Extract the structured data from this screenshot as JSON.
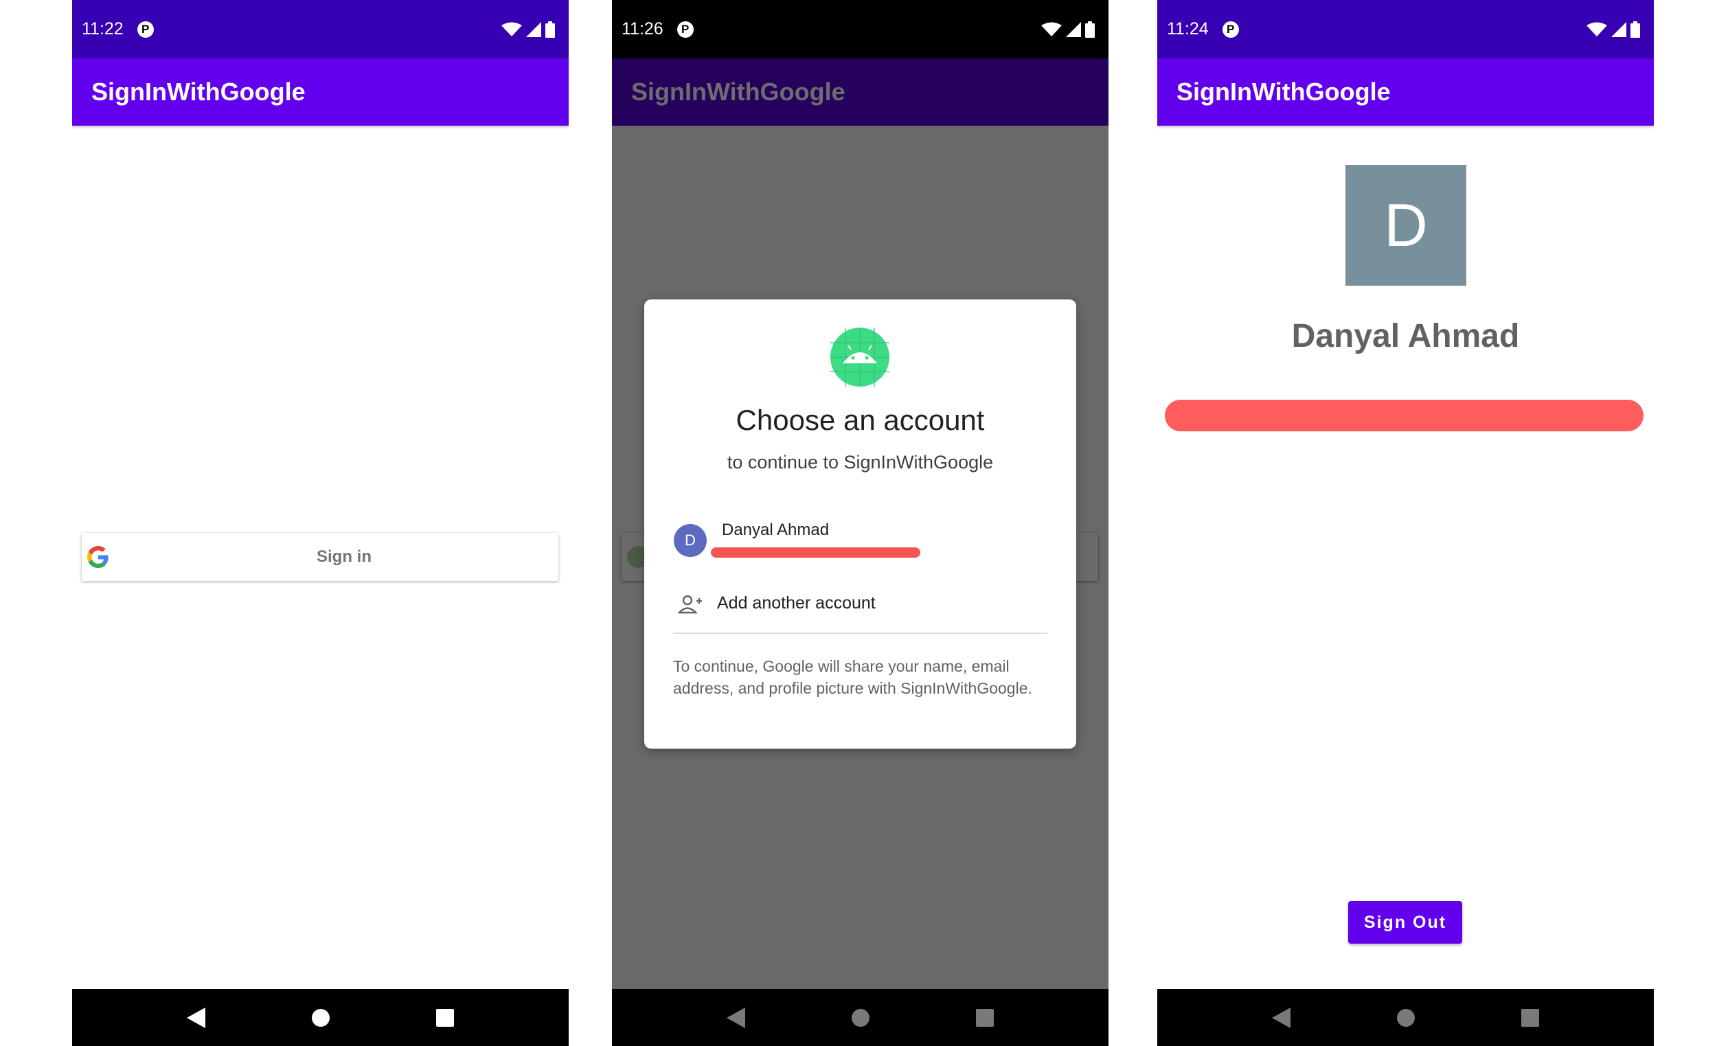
{
  "screens": [
    {
      "time": "11:22",
      "app_title": "SignInWithGoogle",
      "signin_label": "Sign in"
    },
    {
      "time": "11:26",
      "app_title": "SignInWithGoogle",
      "dialog": {
        "title": "Choose an account",
        "subtitle": "to continue to SignInWithGoogle",
        "account_initial": "D",
        "account_name": "Danyal Ahmad",
        "add_account": "Add another account",
        "note": "To continue, Google will share your name, email address, and profile picture with SignInWithGoogle."
      }
    },
    {
      "time": "11:24",
      "app_title": "SignInWithGoogle",
      "profile_initial": "D",
      "profile_name": "Danyal Ahmad",
      "signout_label": "Sign Out"
    }
  ],
  "status_badge": "P",
  "icons": {
    "status": [
      "wifi-icon",
      "cell-signal-icon",
      "battery-icon"
    ],
    "nav": [
      "back-icon",
      "home-icon",
      "recents-icon"
    ],
    "google": "google-g-icon",
    "android": "android-icon",
    "add_person": "person-add-icon"
  },
  "colors": {
    "status_bar": "#3700b3",
    "app_bar": "#6200ee",
    "status_bar_dimmed": "#000000",
    "app_bar_dimmed": "#26005d",
    "app_title_dimmed": "#6d6d6d",
    "scrim": "#696969",
    "avatar_square": "#78909c",
    "account_avatar": "#5c6bc0",
    "android_logo": "#3ddc84",
    "redaction": "#f35454"
  }
}
